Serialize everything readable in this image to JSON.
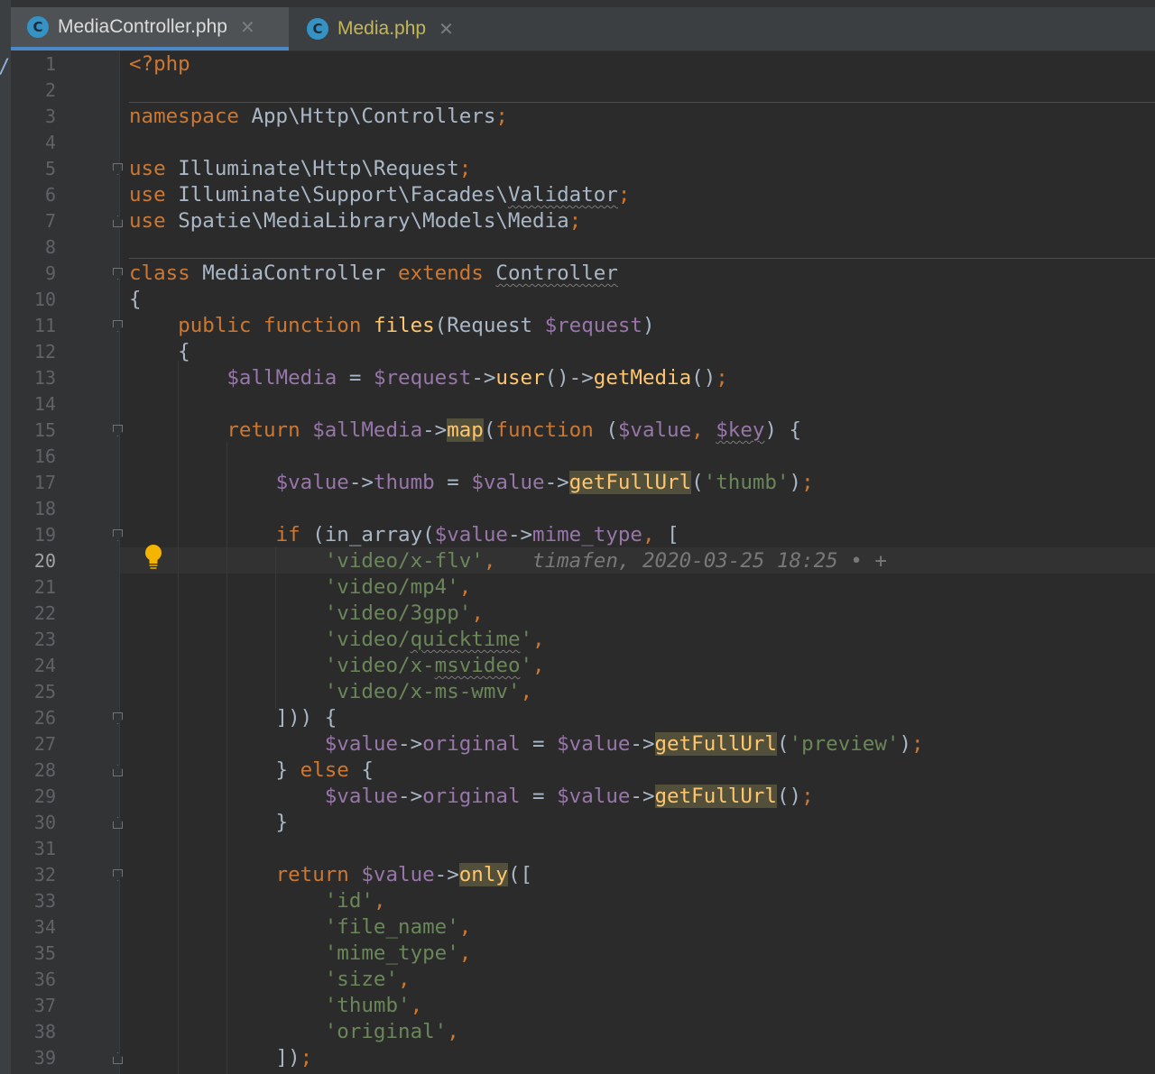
{
  "tabs": [
    {
      "label": "MediaController.php",
      "icon": "C",
      "active": true
    },
    {
      "label": "Media.php",
      "icon": "C",
      "active": false
    }
  ],
  "left_strip_glyph": "/",
  "current_line": 20,
  "blame_annotation": "timafen, 2020-03-25 18:25 • +",
  "colors": {
    "background": "#2b2b2b",
    "keyword": "#cc7832",
    "variable": "#9876aa",
    "function": "#ffc66d",
    "string": "#6a8759",
    "default": "#a9b7c6"
  },
  "lines": [
    {
      "n": "1",
      "tokens": [
        {
          "t": "<?php",
          "c": "kw"
        }
      ]
    },
    {
      "n": "2",
      "tokens": []
    },
    {
      "n": "3",
      "tokens": [
        {
          "t": "namespace ",
          "c": "kw"
        },
        {
          "t": "App\\Http\\Controllers"
        },
        {
          "t": ";",
          "c": "kw"
        }
      ]
    },
    {
      "n": "4",
      "tokens": []
    },
    {
      "n": "5",
      "fold": "open",
      "tokens": [
        {
          "t": "use ",
          "c": "kw"
        },
        {
          "t": "Illuminate\\Http\\Request"
        },
        {
          "t": ";",
          "c": "kw"
        }
      ]
    },
    {
      "n": "6",
      "tokens": [
        {
          "t": "use ",
          "c": "kw"
        },
        {
          "t": "Illuminate\\Support\\Facades\\"
        },
        {
          "t": "Validator",
          "c": "uline"
        },
        {
          "t": ";",
          "c": "kw"
        }
      ]
    },
    {
      "n": "7",
      "fold": "close",
      "tokens": [
        {
          "t": "use ",
          "c": "kw"
        },
        {
          "t": "Spatie\\MediaLibrary\\Models\\Media"
        },
        {
          "t": ";",
          "c": "kw"
        }
      ]
    },
    {
      "n": "8",
      "tokens": []
    },
    {
      "n": "9",
      "fold": "open",
      "tokens": [
        {
          "t": "class ",
          "c": "kw"
        },
        {
          "t": "MediaController "
        },
        {
          "t": "extends ",
          "c": "kw"
        },
        {
          "t": "Controller",
          "c": "uline"
        }
      ]
    },
    {
      "n": "10",
      "tokens": [
        {
          "t": "{"
        }
      ]
    },
    {
      "n": "11",
      "fold": "open",
      "tokens": [
        {
          "t": "    "
        },
        {
          "t": "public function ",
          "c": "kw"
        },
        {
          "t": "files",
          "c": "fn"
        },
        {
          "t": "(Request "
        },
        {
          "t": "$request",
          "c": "var"
        },
        {
          "t": ")"
        }
      ]
    },
    {
      "n": "12",
      "tokens": [
        {
          "t": "    {"
        }
      ]
    },
    {
      "n": "13",
      "tokens": [
        {
          "t": "        "
        },
        {
          "t": "$allMedia",
          "c": "var"
        },
        {
          "t": " = "
        },
        {
          "t": "$request",
          "c": "var"
        },
        {
          "t": "->"
        },
        {
          "t": "user",
          "c": "fn"
        },
        {
          "t": "()->"
        },
        {
          "t": "getMedia",
          "c": "fn"
        },
        {
          "t": "()"
        },
        {
          "t": ";",
          "c": "kw"
        }
      ]
    },
    {
      "n": "14",
      "tokens": []
    },
    {
      "n": "15",
      "fold": "open",
      "tokens": [
        {
          "t": "        "
        },
        {
          "t": "return ",
          "c": "kw"
        },
        {
          "t": "$allMedia",
          "c": "var"
        },
        {
          "t": "->"
        },
        {
          "t": "map",
          "c": "hl"
        },
        {
          "t": "("
        },
        {
          "t": "function ",
          "c": "kw"
        },
        {
          "t": "("
        },
        {
          "t": "$value",
          "c": "var"
        },
        {
          "t": ", ",
          "c": "kw"
        },
        {
          "t": "$key",
          "c": "var uline"
        },
        {
          "t": ") {"
        }
      ]
    },
    {
      "n": "16",
      "tokens": []
    },
    {
      "n": "17",
      "tokens": [
        {
          "t": "            "
        },
        {
          "t": "$value",
          "c": "var"
        },
        {
          "t": "->"
        },
        {
          "t": "thumb",
          "c": "var"
        },
        {
          "t": " = "
        },
        {
          "t": "$value",
          "c": "var"
        },
        {
          "t": "->"
        },
        {
          "t": "getFullUrl",
          "c": "hl"
        },
        {
          "t": "("
        },
        {
          "t": "'thumb'",
          "c": "str"
        },
        {
          "t": ")"
        },
        {
          "t": ";",
          "c": "kw"
        }
      ]
    },
    {
      "n": "18",
      "tokens": []
    },
    {
      "n": "19",
      "fold": "open",
      "tokens": [
        {
          "t": "            "
        },
        {
          "t": "if ",
          "c": "kw"
        },
        {
          "t": "(in_array("
        },
        {
          "t": "$value",
          "c": "var"
        },
        {
          "t": "->"
        },
        {
          "t": "mime_type",
          "c": "var"
        },
        {
          "t": ", ",
          "c": "kw"
        },
        {
          "t": "["
        }
      ]
    },
    {
      "n": "20",
      "tokens": [
        {
          "t": "                "
        },
        {
          "t": "'video/x-flv'",
          "c": "str"
        },
        {
          "t": ",",
          "c": "kw"
        },
        {
          "t": "   "
        },
        {
          "t": "timafen, 2020-03-25 18:25 • +",
          "c": "anno"
        }
      ]
    },
    {
      "n": "21",
      "tokens": [
        {
          "t": "                "
        },
        {
          "t": "'video/mp4'",
          "c": "str"
        },
        {
          "t": ",",
          "c": "kw"
        }
      ]
    },
    {
      "n": "22",
      "tokens": [
        {
          "t": "                "
        },
        {
          "t": "'video/3gpp'",
          "c": "str"
        },
        {
          "t": ",",
          "c": "kw"
        }
      ]
    },
    {
      "n": "23",
      "tokens": [
        {
          "t": "                "
        },
        {
          "t": "'video/",
          "c": "str"
        },
        {
          "t": "quicktime",
          "c": "str uline"
        },
        {
          "t": "'",
          "c": "str"
        },
        {
          "t": ",",
          "c": "kw"
        }
      ]
    },
    {
      "n": "24",
      "tokens": [
        {
          "t": "                "
        },
        {
          "t": "'video/x-",
          "c": "str"
        },
        {
          "t": "msvideo",
          "c": "str uline"
        },
        {
          "t": "'",
          "c": "str"
        },
        {
          "t": ",",
          "c": "kw"
        }
      ]
    },
    {
      "n": "25",
      "tokens": [
        {
          "t": "                "
        },
        {
          "t": "'video/x-ms-wmv'",
          "c": "str"
        },
        {
          "t": ",",
          "c": "kw"
        }
      ]
    },
    {
      "n": "26",
      "fold": "open",
      "tokens": [
        {
          "t": "            ])) {"
        }
      ]
    },
    {
      "n": "27",
      "tokens": [
        {
          "t": "                "
        },
        {
          "t": "$value",
          "c": "var"
        },
        {
          "t": "->"
        },
        {
          "t": "original",
          "c": "var"
        },
        {
          "t": " = "
        },
        {
          "t": "$value",
          "c": "var"
        },
        {
          "t": "->"
        },
        {
          "t": "getFullUrl",
          "c": "hl"
        },
        {
          "t": "("
        },
        {
          "t": "'preview'",
          "c": "str"
        },
        {
          "t": ")"
        },
        {
          "t": ";",
          "c": "kw"
        }
      ]
    },
    {
      "n": "28",
      "fold": "close",
      "tokens": [
        {
          "t": "            } "
        },
        {
          "t": "else ",
          "c": "kw"
        },
        {
          "t": "{"
        }
      ]
    },
    {
      "n": "29",
      "tokens": [
        {
          "t": "                "
        },
        {
          "t": "$value",
          "c": "var"
        },
        {
          "t": "->"
        },
        {
          "t": "original",
          "c": "var"
        },
        {
          "t": " = "
        },
        {
          "t": "$value",
          "c": "var"
        },
        {
          "t": "->"
        },
        {
          "t": "getFullUrl",
          "c": "hl"
        },
        {
          "t": "()"
        },
        {
          "t": ";",
          "c": "kw"
        }
      ]
    },
    {
      "n": "30",
      "fold": "close",
      "tokens": [
        {
          "t": "            }"
        }
      ]
    },
    {
      "n": "31",
      "tokens": []
    },
    {
      "n": "32",
      "fold": "open",
      "tokens": [
        {
          "t": "            "
        },
        {
          "t": "return ",
          "c": "kw"
        },
        {
          "t": "$value",
          "c": "var"
        },
        {
          "t": "->"
        },
        {
          "t": "only",
          "c": "hl"
        },
        {
          "t": "(["
        }
      ]
    },
    {
      "n": "33",
      "tokens": [
        {
          "t": "                "
        },
        {
          "t": "'id'",
          "c": "str"
        },
        {
          "t": ",",
          "c": "kw"
        }
      ]
    },
    {
      "n": "34",
      "tokens": [
        {
          "t": "                "
        },
        {
          "t": "'file_name'",
          "c": "str"
        },
        {
          "t": ",",
          "c": "kw"
        }
      ]
    },
    {
      "n": "35",
      "tokens": [
        {
          "t": "                "
        },
        {
          "t": "'mime_type'",
          "c": "str"
        },
        {
          "t": ",",
          "c": "kw"
        }
      ]
    },
    {
      "n": "36",
      "tokens": [
        {
          "t": "                "
        },
        {
          "t": "'size'",
          "c": "str"
        },
        {
          "t": ",",
          "c": "kw"
        }
      ]
    },
    {
      "n": "37",
      "tokens": [
        {
          "t": "                "
        },
        {
          "t": "'thumb'",
          "c": "str"
        },
        {
          "t": ",",
          "c": "kw"
        }
      ]
    },
    {
      "n": "38",
      "tokens": [
        {
          "t": "                "
        },
        {
          "t": "'original'",
          "c": "str"
        },
        {
          "t": ",",
          "c": "kw"
        }
      ]
    },
    {
      "n": "39",
      "fold": "close",
      "tokens": [
        {
          "t": "            ])"
        },
        {
          "t": ";",
          "c": "kw"
        }
      ]
    }
  ]
}
